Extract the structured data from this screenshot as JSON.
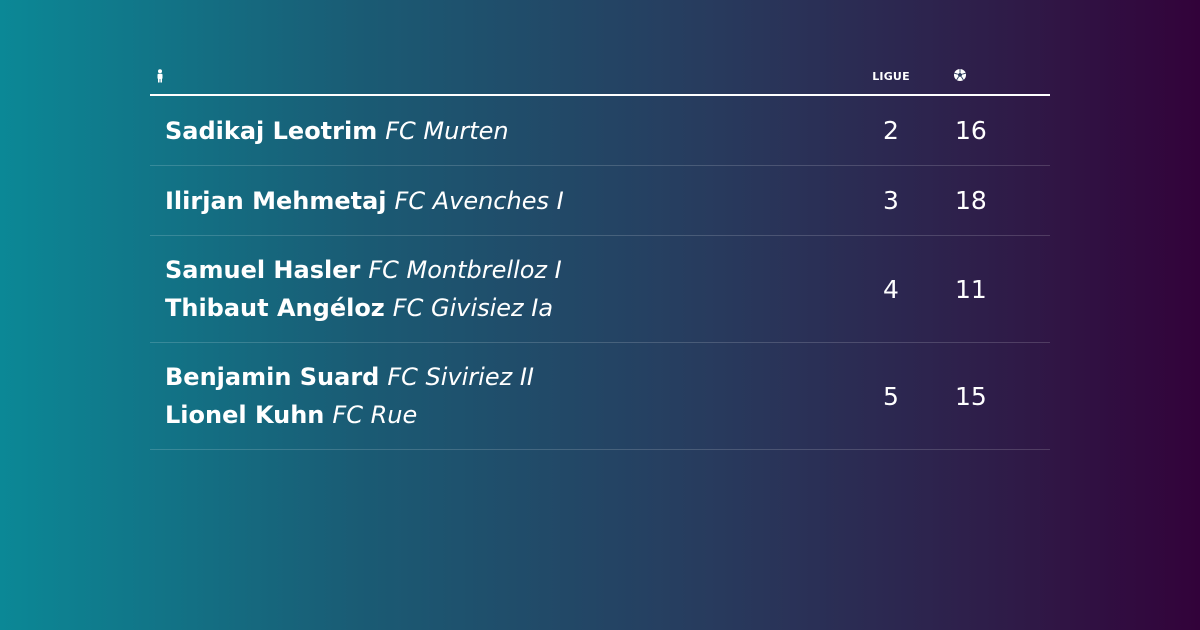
{
  "header": {
    "player_icon": "player-figure-icon",
    "league_label": "LIGUE",
    "goals_icon": "soccer-ball-icon"
  },
  "rows": [
    {
      "players": [
        {
          "name": "Sadikaj Leotrim",
          "club": "FC Murten"
        }
      ],
      "league": "2",
      "goals": "16"
    },
    {
      "players": [
        {
          "name": "Ilirjan Mehmetaj",
          "club": "FC Avenches I"
        }
      ],
      "league": "3",
      "goals": "18"
    },
    {
      "players": [
        {
          "name": "Samuel Hasler",
          "club": "FC Montbrelloz I"
        },
        {
          "name": "Thibaut Angéloz",
          "club": "FC Givisiez Ia"
        }
      ],
      "league": "4",
      "goals": "11"
    },
    {
      "players": [
        {
          "name": "Benjamin Suard",
          "club": "FC Siviriez II"
        },
        {
          "name": "Lionel Kuhn",
          "club": "FC Rue"
        }
      ],
      "league": "5",
      "goals": "15"
    }
  ]
}
